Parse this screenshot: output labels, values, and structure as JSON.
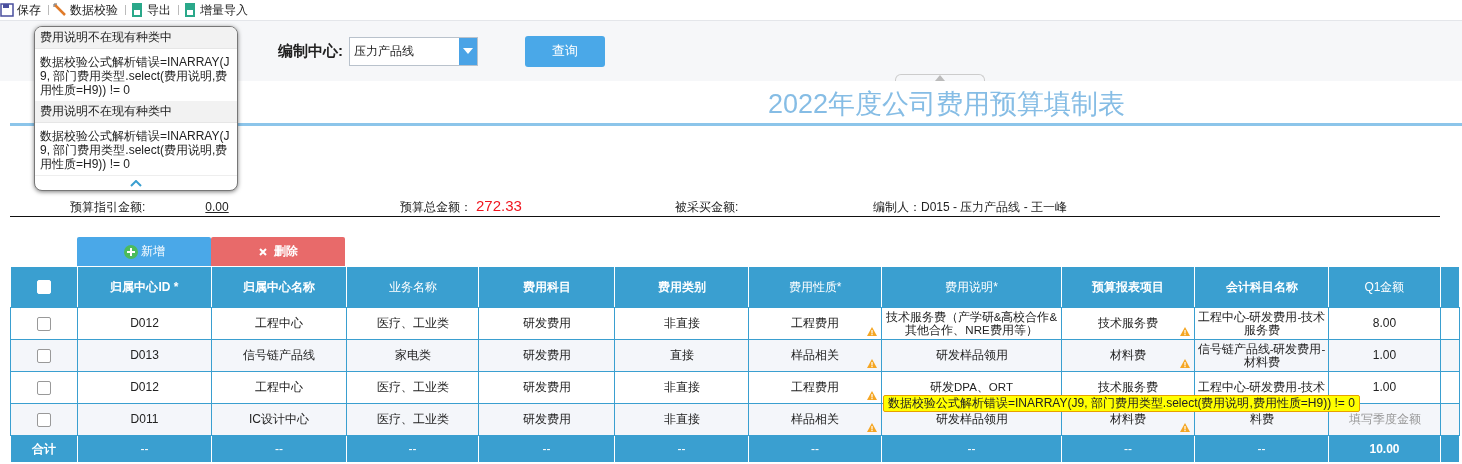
{
  "toolbar": [
    {
      "kind": "save",
      "label": "保存"
    },
    {
      "kind": "validate",
      "label": "数据校验"
    },
    {
      "kind": "export",
      "label": "导出"
    },
    {
      "kind": "import",
      "label": "增量导入"
    }
  ],
  "filter": {
    "label": "编制中心:",
    "value": "压力产品线",
    "button": "查询"
  },
  "title": "2022年度公司费用预算填制表",
  "summary": [
    {
      "kind": "link",
      "label": "预算指引金额:",
      "value": "0.00"
    },
    {
      "kind": "highlight",
      "label": "预算总金额：",
      "value": "272.33"
    },
    {
      "kind": "plain",
      "label": "被采买金额:"
    },
    {
      "kind": "plain",
      "label": "编制人：",
      "value": "D015 - 压力产品线 - 王一峰"
    }
  ],
  "actions": [
    {
      "kind": "add",
      "label": "新增"
    },
    {
      "kind": "delete",
      "label": "删除"
    }
  ],
  "table": {
    "select_all": {
      "checked": false
    },
    "columns": [
      {
        "label": "归属中心ID *",
        "bold": true
      },
      {
        "label": "归属中心名称",
        "bold": true
      },
      {
        "label": "业务名称",
        "bold": false
      },
      {
        "label": "费用科目",
        "bold": true
      },
      {
        "label": "费用类别",
        "bold": true
      },
      {
        "label": "费用性质*",
        "bold": false
      },
      {
        "label": "费用说明*",
        "bold": false
      },
      {
        "label": "预算报表项目",
        "bold": true
      },
      {
        "label": "会计科目名称",
        "bold": true
      },
      {
        "label": "Q1金额",
        "bold": false
      }
    ],
    "rows": [
      {
        "checked": false,
        "cells": [
          "D012",
          "工程中心",
          "医疗、工业类",
          "研发费用",
          "非直接",
          "工程费用",
          "技术服务费（产学研&高校合作&其他合作、NRE费用等）",
          "技术服务费",
          "工程中心-研发费用-技术服务费",
          "8.00"
        ],
        "warn_nature": true,
        "warn_budget": true
      },
      {
        "checked": false,
        "cells": [
          "D013",
          "信号链产品线",
          "家电类",
          "研发费用",
          "直接",
          "样品相关",
          "研发样品领用",
          "材料费",
          "信号链产品线-研发费用-材料费",
          "1.00"
        ],
        "warn_nature": true,
        "warn_budget": true
      },
      {
        "checked": false,
        "cells": [
          "D012",
          "工程中心",
          "医疗、工业类",
          "研发费用",
          "非直接",
          "工程费用",
          "研发DPA、ORT",
          "技术服务费",
          "工程中心-研发费用-技术",
          "1.00"
        ],
        "warn_nature": true,
        "warn_budget": false
      },
      {
        "checked": false,
        "cells": [
          "D011",
          "IC设计中心",
          "医疗、工业类",
          "研发费用",
          "非直接",
          "样品相关",
          "研发样品领用",
          "材料费",
          "料费"
        ],
        "q1_placeholder": "填写季度金额",
        "warn_nature": true,
        "warn_budget": true
      }
    ],
    "footer": {
      "label": "合计",
      "cells": [
        "--",
        "--",
        "--",
        "--",
        "--",
        "--",
        "--",
        "--",
        "--",
        "10.00"
      ]
    }
  },
  "popup": {
    "items": [
      {
        "title": "费用说明不在现有种类中",
        "message": "数据校验公式解析错误=INARRAY(J9, 部门费用类型.select(费用说明,费用性质=H9)) != 0"
      },
      {
        "title": "费用说明不在现有种类中",
        "message": "数据校验公式解析错误=INARRAY(J9, 部门费用类型.select(费用说明,费用性质=H9)) != 0"
      }
    ]
  },
  "tooltip": {
    "text": "数据校验公式解析错误=INARRAY(J9, 部门费用类型.select(费用说明,费用性质=H9)) != 0"
  }
}
